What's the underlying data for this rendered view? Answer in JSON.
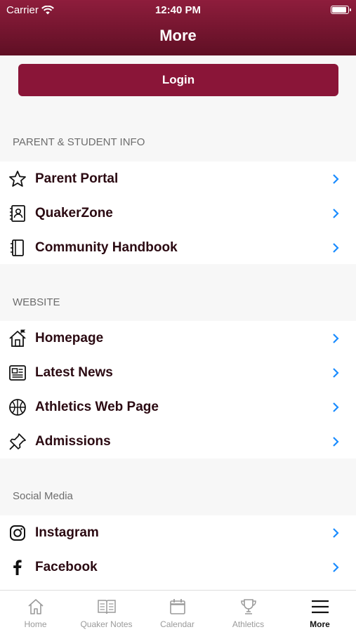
{
  "status_bar": {
    "carrier": "Carrier",
    "time": "12:40 PM"
  },
  "header": {
    "title": "More"
  },
  "login": {
    "label": "Login"
  },
  "sections": {
    "parent": {
      "title": "PARENT & STUDENT INFO",
      "items": [
        {
          "label": "Parent Portal",
          "icon": "star-icon"
        },
        {
          "label": "QuakerZone",
          "icon": "contact-card-icon"
        },
        {
          "label": "Community Handbook",
          "icon": "notebook-icon"
        }
      ]
    },
    "website": {
      "title": "WEBSITE",
      "items": [
        {
          "label": "Homepage",
          "icon": "house-icon"
        },
        {
          "label": "Latest News",
          "icon": "newspaper-icon"
        },
        {
          "label": "Athletics Web Page",
          "icon": "basketball-icon"
        },
        {
          "label": "Admissions",
          "icon": "pushpin-icon"
        }
      ]
    },
    "social": {
      "title": "Social Media",
      "items": [
        {
          "label": "Instagram",
          "icon": "instagram-icon"
        },
        {
          "label": "Facebook",
          "icon": "facebook-icon"
        }
      ]
    }
  },
  "tabbar": {
    "tabs": [
      {
        "label": "Home",
        "icon": "home-icon"
      },
      {
        "label": "Quaker Notes",
        "icon": "book-icon"
      },
      {
        "label": "Calendar",
        "icon": "calendar-icon"
      },
      {
        "label": "Athletics",
        "icon": "trophy-icon"
      },
      {
        "label": "More",
        "icon": "menu-icon",
        "active": true
      }
    ]
  },
  "colors": {
    "brand": "#8a1538",
    "chevron": "#1a8cff",
    "text": "#2b0a12"
  }
}
